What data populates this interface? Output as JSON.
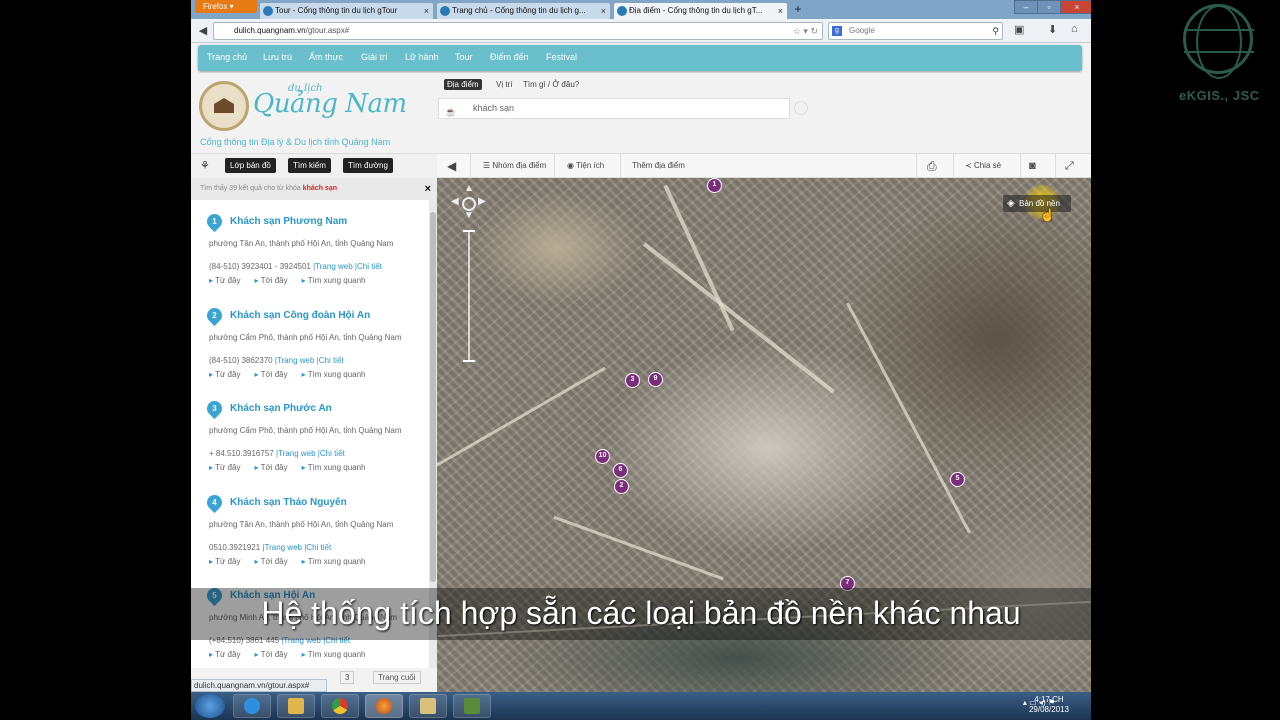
{
  "browser": {
    "menu_label": "Firefox",
    "tabs": [
      {
        "title": "Tour - Cổng thông tin du lịch gTour",
        "active": false
      },
      {
        "title": "Trang chủ - Cổng thông tin du lịch g...",
        "active": false
      },
      {
        "title": "Địa điểm - Cổng thông tin du lịch gT...",
        "active": true
      }
    ],
    "new_tab": "+",
    "url_host": "dulich.quangnam.vn",
    "url_path": "/gtour.aspx#",
    "search_placeholder": "Google",
    "status_url": "dulich.quangnam.vn/gtour.aspx#"
  },
  "site": {
    "nav": [
      "Trang chủ",
      "Lưu trú",
      "Ẩm thực",
      "Giải trí",
      "Lữ hành",
      "Tour",
      "Điểm đến",
      "Festival"
    ],
    "brand_small": "du lịch",
    "brand": "Quảng Nam",
    "slogan": "Cổng thông tin Địa lý & Du lịch tỉnh Quảng Nam",
    "search_tabs": [
      "Địa điểm",
      "Vị trí",
      "Tìm gì / Ở đâu?"
    ],
    "query": "khách sạn"
  },
  "left_panel": {
    "buttons": [
      "Lớp bản đồ",
      "Tìm kiếm",
      "Tìm đường"
    ],
    "result_text": "Tìm thấy 39 kết quả cho từ khóa",
    "keyword": "khách sạn",
    "close": "×",
    "actions": [
      "Từ đây",
      "Tới đây",
      "Tìm xung quanh"
    ],
    "results": [
      {
        "num": "1",
        "name": "Khách sạn Phương Nam",
        "addr": "phường Tân An, thành phố Hội An, tỉnh Quảng Nam",
        "phone": "(84-510) 3923401 - 3924501",
        "web": "|Trang web",
        "detail": "|Chi tiết"
      },
      {
        "num": "2",
        "name": "Khách sạn Công đoàn Hội An",
        "addr": "phường Cẩm Phô, thành phố Hội An, tỉnh Quảng Nam",
        "phone": "(84-510) 3862370",
        "web": "|Trang web",
        "detail": "|Chi tiết"
      },
      {
        "num": "3",
        "name": "Khách sạn Phước An",
        "addr": "phường Cẩm Phô, thành phố Hội An, tỉnh Quảng Nam",
        "phone": "+ 84.510.3916757",
        "web": "|Trang web",
        "detail": "|Chi tiết"
      },
      {
        "num": "4",
        "name": "Khách sạn Thảo Nguyên",
        "addr": "phường Tân An, thành phố Hội An, tỉnh Quảng Nam",
        "phone": "0510.3921921",
        "web": "|Trang web",
        "detail": "|Chi tiết"
      },
      {
        "num": "5",
        "name": "Khách sạn Hội An",
        "addr": "phường Minh An, thành phố Hội An, tỉnh Quảng Nam",
        "phone": "(+84.510) 3861 445",
        "web": "|Trang web",
        "detail": "|Chi tiết"
      }
    ],
    "pager_page": "3",
    "pager_last": "Trang cuối"
  },
  "map_toolbar": {
    "group": "Nhóm địa điểm",
    "utility": "Tiện ích",
    "add_place": "Thêm địa điểm",
    "share": "Chia sẻ"
  },
  "map": {
    "basemap_button": "Bản đồ nền",
    "markers": [
      "1",
      "3",
      "9",
      "10",
      "6",
      "2",
      "5",
      "7"
    ]
  },
  "subtitle": "Hệ thống tích hợp sẵn các loại bản đồ nền khác nhau",
  "taskbar": {
    "time": "4:17 CH",
    "date": "29/08/2013"
  },
  "watermark": "eKGIS., JSC"
}
